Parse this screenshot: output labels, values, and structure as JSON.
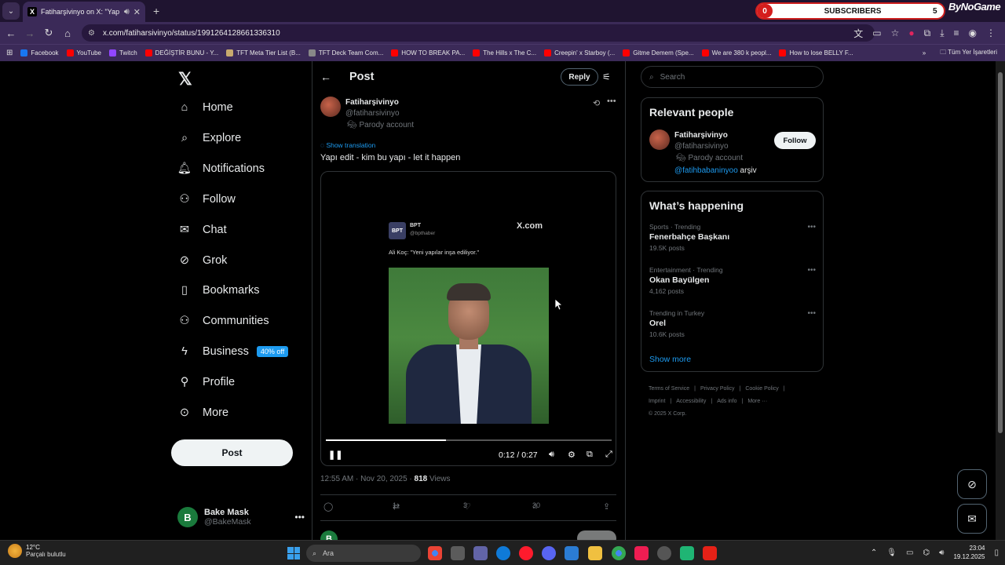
{
  "browser": {
    "tab_title": "Fatiharşivinyo on X: \"Yapı e...",
    "url": "x.com/fatiharsivinyo/status/1991264128661336310",
    "subscribers": {
      "count": "0",
      "label": "SUBSCRIBERS",
      "goal": "5"
    },
    "brand": "ByNoGame",
    "bookmarks": [
      {
        "label": "Facebook",
        "color": "#1877f2"
      },
      {
        "label": "YouTube",
        "color": "#ff0000"
      },
      {
        "label": "Twitch",
        "color": "#9146ff"
      },
      {
        "label": "DEĞİŞTİR BUNU - Y...",
        "color": "#ff0000"
      },
      {
        "label": "TFT Meta Tier List (B...",
        "color": "#c8aa6e"
      },
      {
        "label": "TFT Deck Team Com...",
        "color": "#888888"
      },
      {
        "label": "HOW TO BREAK PA...",
        "color": "#ff0000"
      },
      {
        "label": "The Hills x The C...",
        "color": "#ff0000"
      },
      {
        "label": "Creepin' x Starboy (...",
        "color": "#ff0000"
      },
      {
        "label": "Gitme Demem (Spe...",
        "color": "#ff0000"
      },
      {
        "label": "We are 380 k peopl...",
        "color": "#ff0000"
      },
      {
        "label": "How to lose BELLY F...",
        "color": "#ff0000"
      }
    ],
    "bookmarks_folder": "Tüm Yer İşaretleri"
  },
  "leftnav": {
    "items": [
      {
        "label": "Home",
        "icon": "home-icon"
      },
      {
        "label": "Explore",
        "icon": "search-icon"
      },
      {
        "label": "Notifications",
        "icon": "bell-icon"
      },
      {
        "label": "Follow",
        "icon": "follow-icon"
      },
      {
        "label": "Chat",
        "icon": "mail-icon"
      },
      {
        "label": "Grok",
        "icon": "grok-icon"
      },
      {
        "label": "Bookmarks",
        "icon": "bookmark-icon"
      },
      {
        "label": "Communities",
        "icon": "communities-icon"
      },
      {
        "label": "Business",
        "icon": "lightning-icon"
      },
      {
        "label": "Profile",
        "icon": "person-icon"
      },
      {
        "label": "More",
        "icon": "more-circle-icon"
      }
    ],
    "business_badge": "40% off",
    "post_button": "Post",
    "account": {
      "initial": "B",
      "name": "Bake Mask",
      "handle": "@BakeMask"
    }
  },
  "main": {
    "header_title": "Post",
    "reply_button": "Reply",
    "post": {
      "author_name": "Fatiharşivinyo",
      "author_handle": "@fatiharsivinyo",
      "parody_label": "Parody account",
      "show_translation": "Show translation",
      "text": "Yapı edit - kim bu yapı - let it happen",
      "video": {
        "embedded_name": "BPT",
        "embedded_handle": "@bpthaber",
        "embedded_site": "X.com",
        "embedded_quote": "Ali Koç: \"Yeni yapılar inşa ediliyor.\"",
        "time": "0:12 / 0:27",
        "progress": 0.42
      },
      "timestamp": "12:55 AM · Nov 20, 2025 ·",
      "views_count": "818",
      "views_label": "Views",
      "retweets": "1",
      "likes": "3",
      "bookmarks": "30",
      "reply_preview_initial": "B"
    }
  },
  "right": {
    "search_placeholder": "Search",
    "relevant_people": {
      "title": "Relevant people",
      "name": "Fatiharşivinyo",
      "handle": "@fatiharsivinyo",
      "parody_label": "Parody account",
      "bio_mention": "@fatihbabaninyoo",
      "bio_rest": " arşiv",
      "follow_button": "Follow"
    },
    "whats_happening": {
      "title": "What’s happening",
      "trends": [
        {
          "category": "Sports · Trending",
          "topic": "Fenerbahçe Başkanı",
          "posts": "19.5K posts"
        },
        {
          "category": "Entertainment · Trending",
          "topic": "Okan Bayülgen",
          "posts": "4,162 posts"
        },
        {
          "category": "Trending in Turkey",
          "topic": "Orel",
          "posts": "10.6K posts"
        }
      ],
      "show_more": "Show more"
    },
    "footer": {
      "links": [
        "Terms of Service",
        "|",
        "Privacy Policy",
        "|",
        "Cookie Policy",
        "|",
        "Imprint",
        "|",
        "Accessibility",
        "|",
        "Ads info",
        "|",
        "More ···"
      ],
      "copyright": "© 2025 X Corp."
    }
  },
  "taskbar": {
    "temperature": "12°C",
    "weather": "Parçalı bulutlu",
    "search_placeholder": "Ara",
    "time": "23:04",
    "date": "19.12.2025"
  }
}
